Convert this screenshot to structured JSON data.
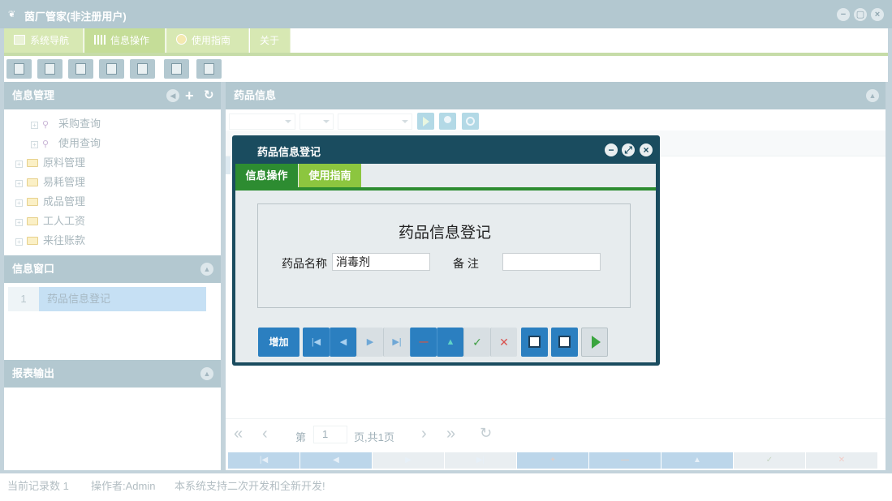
{
  "app": {
    "title": "茵厂管家(非注册用户)"
  },
  "main_tabs": [
    {
      "label": "系统导航"
    },
    {
      "label": "信息操作"
    },
    {
      "label": "使用指南"
    },
    {
      "label": "关于"
    }
  ],
  "left": {
    "info_mgmt": {
      "title": "信息管理",
      "subitems": [
        "采购查询",
        "使用查询"
      ],
      "folders": [
        "原料管理",
        "易耗管理",
        "成品管理",
        "工人工资",
        "来往账款"
      ]
    },
    "info_window": {
      "title": "信息窗口",
      "rows": [
        {
          "index": "1",
          "label": "药品信息登记"
        }
      ]
    },
    "report": {
      "title": "报表输出"
    }
  },
  "right": {
    "title": "药品信息",
    "pager": {
      "page_prefix": "第",
      "page": "1",
      "page_suffix": "页,共1页"
    }
  },
  "dialog": {
    "title": "药品信息登记",
    "tabs": [
      {
        "label": "信息操作"
      },
      {
        "label": "使用指南"
      }
    ],
    "form": {
      "heading": "药品信息登记",
      "name_label": "药品名称",
      "name_value": "消毒剂",
      "remark_label": "备 注",
      "remark_value": ""
    },
    "add_label": "增加"
  },
  "status": {
    "record_count": "当前记录数 1",
    "operator": "操作者:Admin",
    "notice": "本系统支持二次开发和全新开发!"
  },
  "colors": {
    "panel_header": "#b3c8d0",
    "dialog_frame": "#1a4c5f",
    "tab_green": "#2d8c31",
    "tab_lightgreen": "#8cc63f",
    "nav_blue": "#2b7fc0",
    "nav_red": "#d9534f"
  }
}
